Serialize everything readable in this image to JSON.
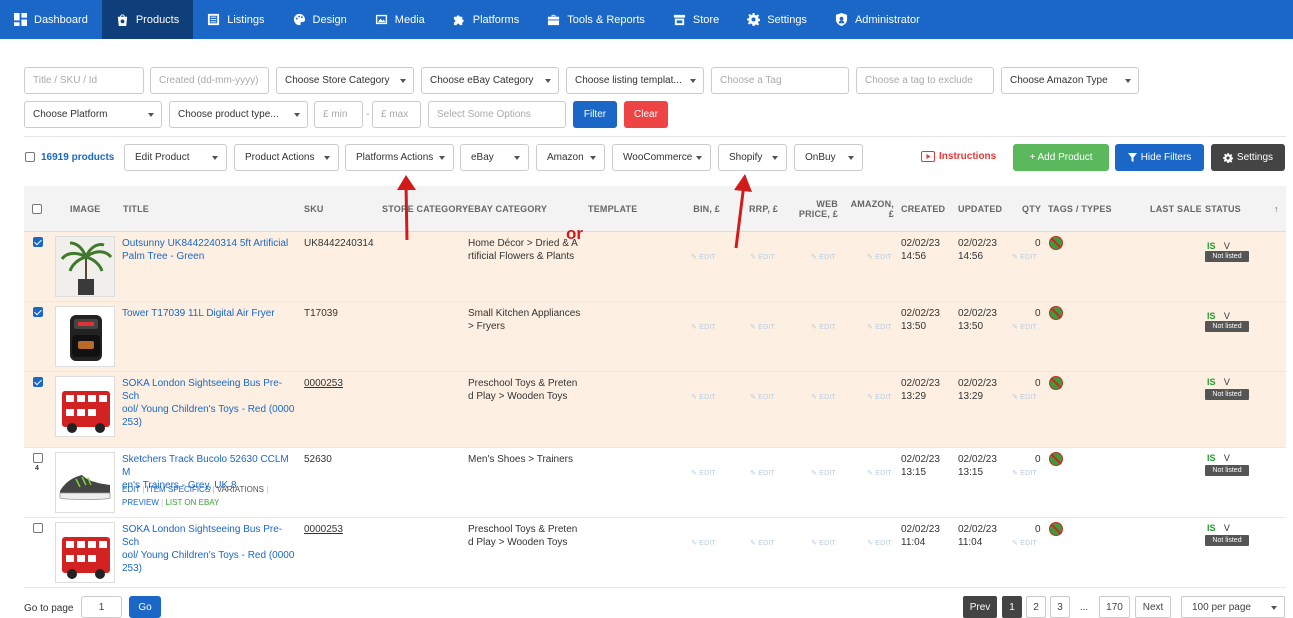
{
  "nav": {
    "items": [
      {
        "label": "Dashboard",
        "icon": "dashboard-icon"
      },
      {
        "label": "Products",
        "icon": "bag-icon",
        "active": true
      },
      {
        "label": "Listings",
        "icon": "listings-icon"
      },
      {
        "label": "Design",
        "icon": "palette-icon"
      },
      {
        "label": "Media",
        "icon": "image-icon"
      },
      {
        "label": "Platforms",
        "icon": "puzzle-icon"
      },
      {
        "label": "Tools & Reports",
        "icon": "briefcase-icon"
      },
      {
        "label": "Store",
        "icon": "store-icon"
      },
      {
        "label": "Settings",
        "icon": "gear-icon"
      },
      {
        "label": "Administrator",
        "icon": "shield-icon"
      }
    ]
  },
  "filters": {
    "title_placeholder": "Title / SKU / Id",
    "created_placeholder": "Created (dd-mm-yyyy)",
    "store_category": "Choose Store Category",
    "ebay_category": "Choose eBay Category",
    "listing_template": "Choose listing templat...",
    "tag": "Choose a Tag",
    "tag_exclude": "Choose a tag to exclude",
    "amazon_type": "Choose Amazon Type",
    "platform": "Choose Platform",
    "product_type": "Choose product type...",
    "min_placeholder": "£ min",
    "range_sep": "-",
    "max_placeholder": "£ max",
    "options_placeholder": "Select Some Options",
    "filter_label": "Filter",
    "clear_label": "Clear"
  },
  "toolbar": {
    "count": "16919 products",
    "edit_product": "Edit Product",
    "product_actions": "Product Actions",
    "platforms_actions": "Platforms Actions",
    "ebay": "eBay",
    "amazon": "Amazon",
    "woocommerce": "WooCommerce",
    "shopify": "Shopify",
    "onbuy": "OnBuy",
    "instructions": "Instructions",
    "add_product": "+ Add Product",
    "hide_filters": "Hide Filters",
    "settings": "Settings"
  },
  "annotation": {
    "text": "or",
    "color": "#d11a1a"
  },
  "table": {
    "headers": {
      "image": "IMAGE",
      "title": "TITLE",
      "sku": "SKU",
      "store_category": "STORE CATEGORY",
      "ebay_category": "EBAY CATEGORY",
      "template": "TEMPLATE",
      "bin": "BIN, £",
      "rrp": "RRP, £",
      "web_price_1": "WEB",
      "web_price_2": "PRICE, £",
      "amazon_1": "AMAZON,",
      "amazon_2": "£",
      "created": "CREATED",
      "updated": "UPDATED",
      "qty": "QTY",
      "tags": "TAGS / TYPES",
      "last_sale": "LAST SALE",
      "status": "STATUS",
      "sort": "↑"
    },
    "edit_label": "EDIT",
    "is_label": "IS",
    "v_label": "V",
    "not_listed": "Not listed",
    "rows": [
      {
        "checked": true,
        "title_1": "Outsunny UK8442240314 5ft Artificial",
        "title_2": "Palm Tree - Green",
        "title_3": "",
        "sku": "UK8442240314",
        "cat_1": "Home Décor > Dried & A",
        "cat_2": "rtificial Flowers & Plants",
        "created_1": "02/02/23",
        "created_2": "14:56",
        "updated_1": "02/02/23",
        "updated_2": "14:56",
        "qty": "0"
      },
      {
        "checked": true,
        "title_1": "Tower T17039 11L Digital Air Fryer",
        "title_2": "",
        "title_3": "",
        "sku": "T17039",
        "cat_1": "Small Kitchen Appliances",
        "cat_2": "> Fryers",
        "created_1": "02/02/23",
        "created_2": "13:50",
        "updated_1": "02/02/23",
        "updated_2": "13:50",
        "qty": "0"
      },
      {
        "checked": true,
        "title_1": "SOKA London Sightseeing Bus Pre-Sch",
        "title_2": "ool/ Young Children's Toys - Red (0000",
        "title_3": "253)",
        "sku": "0000253",
        "cat_1": "Preschool Toys & Preten",
        "cat_2": "d Play > Wooden Toys",
        "created_1": "02/02/23",
        "created_2": "13:29",
        "updated_1": "02/02/23",
        "updated_2": "13:29",
        "qty": "0"
      },
      {
        "checked": false,
        "row_count": "4",
        "title_1": "Sketchers Track Bucolo 52630 CCLM M",
        "title_2": "en's Trainers - Grey, UK 8",
        "title_3": "",
        "sku": "52630",
        "cat_1": "Men's Shoes > Trainers",
        "cat_2": "",
        "created_1": "02/02/23",
        "created_2": "13:15",
        "updated_1": "02/02/23",
        "updated_2": "13:15",
        "qty": "0",
        "actions": {
          "edit": "EDIT",
          "specifics": "ITEM SPECIFICS",
          "variations": "VARIATIONS",
          "preview": "PREVIEW",
          "list": "LIST ON EBAY"
        }
      },
      {
        "checked": false,
        "title_1": "SOKA London Sightseeing Bus Pre-Sch",
        "title_2": "ool/ Young Children's Toys - Red (0000",
        "title_3": "253)",
        "sku": "0000253",
        "cat_1": "Preschool Toys & Preten",
        "cat_2": "d Play > Wooden Toys",
        "created_1": "02/02/23",
        "created_2": "11:04",
        "updated_1": "02/02/23",
        "updated_2": "11:04",
        "qty": "0"
      }
    ]
  },
  "pagination": {
    "goto_label": "Go to page",
    "goto_value": "1",
    "go_label": "Go",
    "prev": "Prev",
    "pages": [
      "1",
      "2",
      "3",
      "...",
      "170"
    ],
    "next": "Next",
    "per_page": "100 per page"
  },
  "colors": {
    "nav_bg": "#1a67c8",
    "nav_active": "#0f3f7a",
    "highlight_row": "#fdf0e2",
    "add_product": "#5cb85c",
    "hide_filters": "#1a67c8",
    "settings_btn": "#444444",
    "clear_btn": "#ee4444",
    "arrow": "#d11a1a"
  }
}
